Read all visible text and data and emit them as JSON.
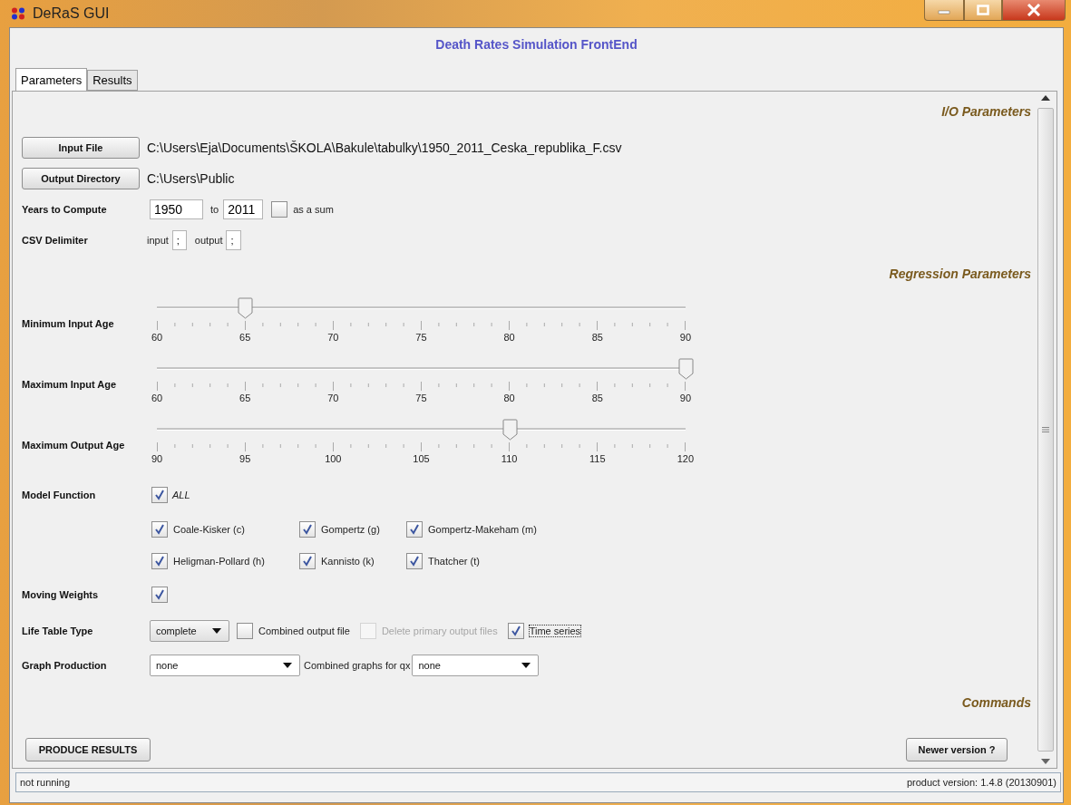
{
  "window": {
    "title": "DeRaS GUI"
  },
  "app_title": "Death Rates Simulation FrontEnd",
  "tabs": [
    {
      "label": "Parameters",
      "selected": true
    },
    {
      "label": "Results",
      "selected": false
    }
  ],
  "io_section": {
    "heading": "I/O Parameters",
    "input_file": {
      "button": "Input File",
      "path": "C:\\Users\\Eja\\Documents\\ŠKOLA\\Bakule\\tabulky\\1950_2011_Ceska_republika_F.csv"
    },
    "output_directory": {
      "button": "Output Directory",
      "path": "C:\\Users\\Public"
    },
    "years": {
      "label": "Years to Compute",
      "from": "1950",
      "to_label": "to",
      "to": "2011",
      "as_sum": {
        "label": "as a sum",
        "checked": false
      }
    },
    "csv": {
      "label": "CSV Delimiter",
      "input_label": "input",
      "input": ";",
      "output_label": "output",
      "output": ";"
    }
  },
  "regression_section": {
    "heading": "Regression Parameters",
    "sliders": [
      {
        "label": "Minimum Input Age",
        "level": 0.1667,
        "ticks": [
          "60",
          "65",
          "70",
          "75",
          "80",
          "85",
          "90"
        ]
      },
      {
        "label": "Maximum Input Age",
        "level": 1,
        "ticks": [
          "60",
          "65",
          "70",
          "75",
          "80",
          "85",
          "90"
        ]
      },
      {
        "label": "Maximum Output Age",
        "level": 0.6667,
        "ticks": [
          "90",
          "95",
          "100",
          "105",
          "110",
          "115",
          "120"
        ]
      }
    ],
    "model_function": {
      "label": "Model Function",
      "all": {
        "label": "ALL",
        "checked": true
      },
      "rows": [
        {
          "items": [
            {
              "label": "Coale-Kisker (c)",
              "checked": true
            },
            {
              "label": "Gompertz (g)",
              "checked": true
            },
            {
              "label": "Gompertz-Makeham (m)",
              "checked": true
            }
          ]
        },
        {
          "items": [
            {
              "label": "Heligman-Pollard (h)",
              "checked": true
            },
            {
              "label": "Kannisto (k)",
              "checked": true
            },
            {
              "label": "Thatcher (t)",
              "checked": true
            }
          ]
        }
      ]
    },
    "moving_weights": {
      "label": "Moving Weights",
      "checked": true
    },
    "life_table": {
      "label": "Life Table Type",
      "type": "complete",
      "options": [
        {
          "label": "Combined output file",
          "checked": false,
          "disabled": false,
          "focused": false
        },
        {
          "label": "Delete primary output files",
          "checked": false,
          "disabled": true,
          "focused": false
        },
        {
          "label": "Time series",
          "checked": true,
          "disabled": false,
          "focused": true
        }
      ]
    },
    "graph_production": {
      "label": "Graph Production",
      "value": "none",
      "combined_label": "Combined graphs for qx",
      "combined_value": "none"
    }
  },
  "commands_section": {
    "heading": "Commands",
    "produce_button": "PRODUCE RESULTS",
    "newer_button": "Newer version ?"
  },
  "status_bar": {
    "state": "not running",
    "version": "product version: 1.4.8 (20130901)"
  }
}
